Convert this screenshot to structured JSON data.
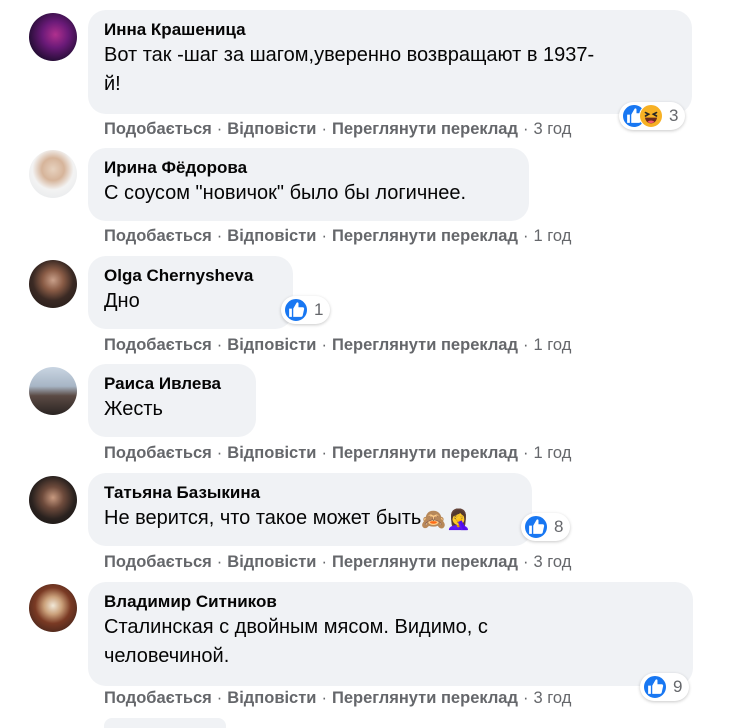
{
  "actions": {
    "like": "Подобається",
    "reply": "Відповісти",
    "translate": "Переглянути переклад",
    "separator": "·"
  },
  "colors": {
    "bubble": "#f0f2f5",
    "meta_text": "#65676b",
    "like_blue": "#1877f2",
    "haha_yellow": "#f7b125"
  },
  "comments": [
    {
      "author": "Инна Крашеница",
      "text": "Вот так -шаг за шагом,уверенно возвращают в 1937-\nй!",
      "time": "3 год",
      "reactions": [
        "like-icon",
        "haha-icon"
      ],
      "reaction_count": "3"
    },
    {
      "author": "Ирина Фёдорова",
      "text": "С соусом \"новичок\" было бы логичнее.",
      "time": "1 год"
    },
    {
      "author": "Olga Chernysheva",
      "text": "Дно",
      "time": "1 год",
      "reactions": [
        "like-icon"
      ],
      "reaction_count": "1"
    },
    {
      "author": "Раиса Ивлева",
      "text": "Жесть",
      "time": "1 год"
    },
    {
      "author": "Татьяна Базыкина",
      "text": "Не верится, что такое может быть",
      "emoji": "🙈🤦‍♀️",
      "time": "3 год",
      "reactions": [
        "like-icon"
      ],
      "reaction_count": "8"
    },
    {
      "author": "Владимир Ситников",
      "text": "Сталинская с двойным мясом. Видимо, с\nчеловечиной.",
      "time": "3 год",
      "reactions": [
        "like-icon"
      ],
      "reaction_count": "9"
    }
  ]
}
